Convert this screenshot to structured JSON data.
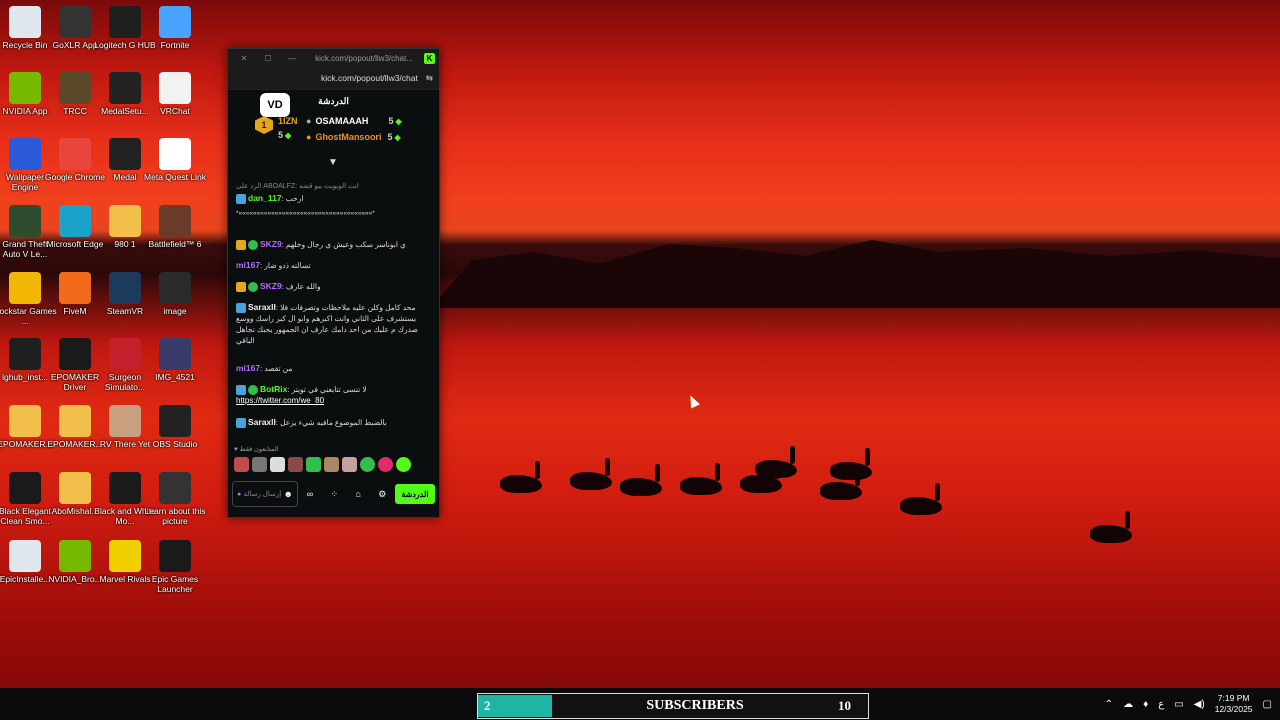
{
  "desktop_icons": [
    {
      "label": "Recycle Bin",
      "icon": "recycle-bin-icon",
      "color": "#dfe7ef"
    },
    {
      "label": "GoXLR App",
      "icon": "goxlr-icon",
      "color": "#333333"
    },
    {
      "label": "Logitech G HUB",
      "icon": "logitech-icon",
      "color": "#1f1f1f"
    },
    {
      "label": "Fortnite",
      "icon": "fortnite-icon",
      "color": "#4aa3ff"
    },
    {
      "label": "NVIDIA App",
      "icon": "nvidia-icon",
      "color": "#76b900"
    },
    {
      "label": "TRCC",
      "icon": "trcc-icon",
      "color": "#5a4a2a"
    },
    {
      "label": "MedalSetu...",
      "icon": "medal-icon",
      "color": "#222222"
    },
    {
      "label": "VRChat",
      "icon": "vrchat-icon",
      "color": "#f2f2f2"
    },
    {
      "label": "Wallpaper Engine",
      "icon": "wallpaper-engine-icon",
      "color": "#2a5ad8"
    },
    {
      "label": "Google Chrome",
      "icon": "chrome-icon",
      "color": "#e8453c"
    },
    {
      "label": "Medal",
      "icon": "medal-icon",
      "color": "#222222"
    },
    {
      "label": "Meta Quest Link",
      "icon": "meta-icon",
      "color": "#ffffff"
    },
    {
      "label": "Grand Theft Auto V Le...",
      "icon": "gta-icon",
      "color": "#2e4d2e"
    },
    {
      "label": "Microsoft Edge",
      "icon": "edge-icon",
      "color": "#1aa2c8"
    },
    {
      "label": "980 1",
      "icon": "folder-icon",
      "color": "#f2c04a"
    },
    {
      "label": "Battlefield™ 6",
      "icon": "battlefield-icon",
      "color": "#6a3a2a"
    },
    {
      "label": "Rockstar Games ...",
      "icon": "rockstar-icon",
      "color": "#f2b705"
    },
    {
      "label": "FiveM",
      "icon": "fivem-icon",
      "color": "#f26a1b"
    },
    {
      "label": "SteamVR",
      "icon": "steamvr-icon",
      "color": "#1b3a5c"
    },
    {
      "label": "image",
      "icon": "image-icon",
      "color": "#2a2a2a"
    },
    {
      "label": "lghub_inst...",
      "icon": "logitech-icon",
      "color": "#1f1f1f"
    },
    {
      "label": "EPOMAKER Driver",
      "icon": "epomaker-icon",
      "color": "#1a1a1a"
    },
    {
      "label": "Surgeon Simulato...",
      "icon": "surgeon-icon",
      "color": "#c2202a"
    },
    {
      "label": "IMG_4521",
      "icon": "image-icon",
      "color": "#3a3a6a"
    },
    {
      "label": "EPOMAKER...",
      "icon": "folder-icon",
      "color": "#f2c04a"
    },
    {
      "label": "EPOMAKER...",
      "icon": "folder-icon",
      "color": "#f2c04a"
    },
    {
      "label": "RV There Yet",
      "icon": "rv-icon",
      "color": "#c8a080"
    },
    {
      "label": "OBS Studio",
      "icon": "obs-icon",
      "color": "#222222"
    },
    {
      "label": "Black Elegant Clean Smo...",
      "icon": "video-icon",
      "color": "#1a1a1a"
    },
    {
      "label": "AboMishal...",
      "icon": "folder-icon",
      "color": "#f2c04a"
    },
    {
      "label": "Black and White Mo...",
      "icon": "video-icon",
      "color": "#1a1a1a"
    },
    {
      "label": "Learn about this picture",
      "icon": "camera-icon",
      "color": "#333333"
    },
    {
      "label": "EpicInstalle...",
      "icon": "disc-icon",
      "color": "#dfe7ef"
    },
    {
      "label": "NVIDIA_Bro...",
      "icon": "nvidia-icon",
      "color": "#76b900"
    },
    {
      "label": "Marvel Rivals",
      "icon": "marvel-icon",
      "color": "#f2d000"
    },
    {
      "label": "Epic Games Launcher",
      "icon": "epic-icon",
      "color": "#1a1a1a"
    }
  ],
  "chat": {
    "window_url_short": "kick.com/popout/llw3/chat...",
    "address": "kick.com/popout/llw3/chat",
    "header_title": "الدردشة",
    "logo_text": "VD",
    "leaders": {
      "rank": "1",
      "first": {
        "name": "1IZN",
        "points": "5"
      },
      "second": {
        "name": "OSAMAAAH",
        "points": "5"
      },
      "third": {
        "name": "GhostMansoori",
        "points": "5"
      }
    },
    "messages": [
      {
        "reply": "الرد على ABOALFZ: انت الويويت بيو قشه"
      },
      {
        "user": "dan_117",
        "color": "#53fc18",
        "text": "ارحب",
        "extra": "*«««««««««««««««««««««««««««««««««««««*"
      },
      {
        "user": "SKZ9",
        "color": "#b56bff",
        "text": "ي ابوناسر سكب وعيش ي رجال وخلهم"
      },
      {
        "user": "mi167",
        "color": "#b56bff",
        "text": "تسالته ذدو ضار"
      },
      {
        "user": "SKZ9",
        "color": "#b56bff",
        "text": "والله عارف"
      },
      {
        "user": "Saraxll",
        "color": "#f0f0f0",
        "text": "محد كامل وكلن عليه ملاحظات وتصرفات فلا يستشرف على الثاني وانت اكبرهم وابو ال كبر راسك ووسع صدرك م عليك من احد دامك عارف ان الجمهور يحبك تجاهل الباقي"
      },
      {
        "user": "mi167",
        "color": "#b56bff",
        "text": "من تقصد"
      },
      {
        "user": "BotRix",
        "color": "#53fc18",
        "text": "لا تنسى تتابعني في تويتر",
        "link": "https://twitter.com/we_80"
      },
      {
        "user": "Saraxll",
        "color": "#f0f0f0",
        "text": "بالضبط الموضوع مافيه شيء يزعل"
      }
    ],
    "viewers_label": "المتابعون فقط",
    "input_placeholder": "إرسال رسالة",
    "send_label": "الدردشة"
  },
  "stream_widget": {
    "count": "2",
    "label": "SUBSCRIBERS",
    "goal": "10",
    "color": "#1fb5a5"
  },
  "taskbar": {
    "time": "7:19 PM",
    "date": "12/3/2025",
    "lang": "ع"
  }
}
